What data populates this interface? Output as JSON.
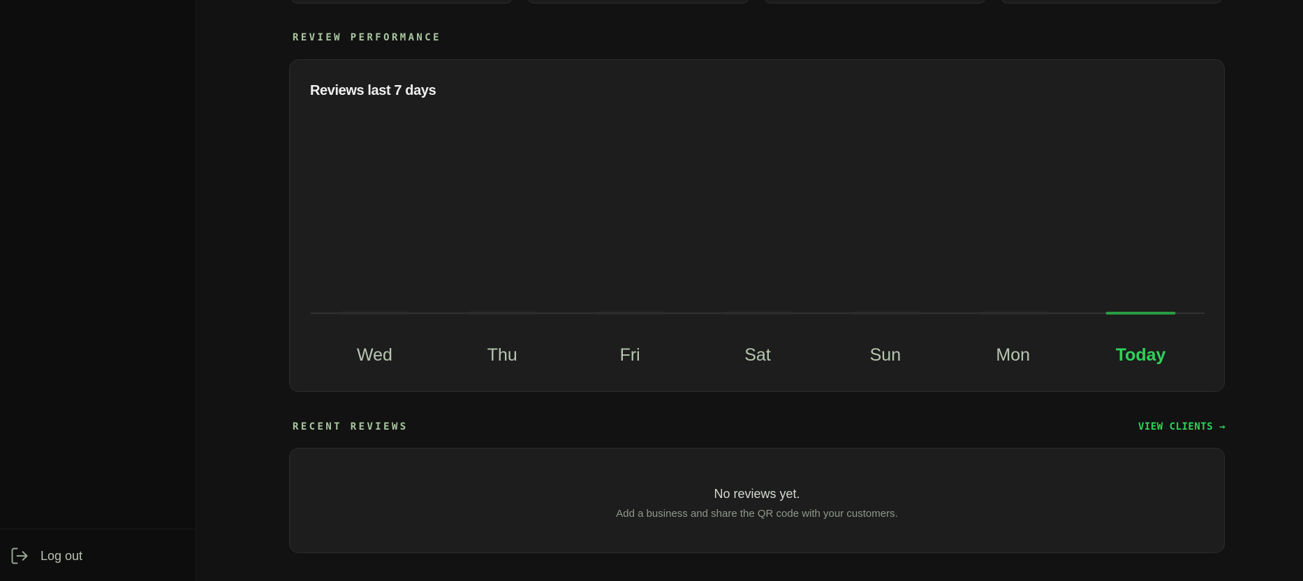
{
  "sidebar": {
    "logout_label": "Log out",
    "logout_icon": "logout-icon"
  },
  "sections": {
    "review_performance": "REVIEW PERFORMANCE",
    "recent_reviews": "RECENT REVIEWS",
    "view_clients": "VIEW CLIENTS →"
  },
  "chart_data": {
    "type": "bar",
    "title": "Reviews last 7 days",
    "categories": [
      "Wed",
      "Thu",
      "Fri",
      "Sat",
      "Sun",
      "Mon",
      "Today"
    ],
    "values": [
      0,
      0,
      0,
      0,
      0,
      0,
      0
    ],
    "highlight": "Today",
    "grid": false,
    "colors": {
      "bar": "#2b2b2b",
      "bar_highlight": "#2a9b45",
      "label": "#b7c6b0",
      "label_highlight": "#2fd25a",
      "baseline": "#3a3a3a"
    }
  },
  "recent_reviews": {
    "empty_title": "No reviews yet.",
    "empty_subtitle": "Add a business and share the QR code with your customers."
  },
  "colors": {
    "background": "#121212",
    "sidebar": "#0d0d0d",
    "card": "#1d1d1d",
    "accent": "#2fd25a"
  }
}
